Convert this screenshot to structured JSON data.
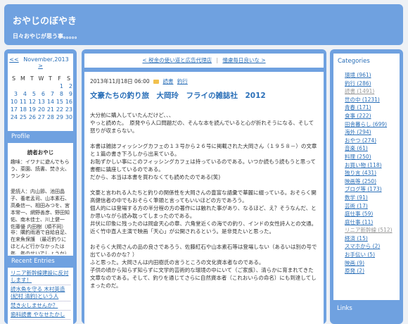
{
  "header": {
    "title": "おやじのぼやき",
    "description": "日々おやじが思う事。。。。。"
  },
  "calendar": {
    "prev": "<<",
    "month": "November,2013",
    "next": ">",
    "rows": [
      [
        "S",
        "M",
        "T",
        "W",
        "T",
        "F",
        "S"
      ],
      [
        "",
        "",
        "",
        "",
        "",
        "1",
        "2"
      ],
      [
        "3",
        "4",
        "5",
        "6",
        "7",
        "8",
        "9"
      ],
      [
        "10",
        "11",
        "12",
        "13",
        "14",
        "15",
        "16"
      ],
      [
        "17",
        "18",
        "19",
        "20",
        "21",
        "22",
        "23"
      ],
      [
        "24",
        "25",
        "26",
        "27",
        "28",
        "29",
        "30"
      ]
    ]
  },
  "profile": {
    "heading": "Profile",
    "name": "読者おやじ",
    "hobby": "趣味：イワナに遊んでもらう、菜園、読書、焚き火、ランタン",
    "fav_authors": "愛読人：内山節、池田晶子、養老孟司、山本素石、高桑信一、相田みつを、宮本常一、網野善彦、野田知佑、南木佳士、川上健一 佐藤優 内田樹（順不同）",
    "note": "非：購釣雨酒で自給自足、在来魚保護 （最近釣りにほとんど行かなかったは年、年のせいでしょうか）"
  },
  "recent": {
    "heading": "Recent Entries",
    "items": [
      "リニア新幹線建設に反対します！",
      "読水魚を守る 木村英造(紀村 清釣)という人",
      "焚き火しませんか？",
      "歯科読書 やなせたかし"
    ]
  },
  "nav": {
    "prev": "< 税金の使い道と広告代理店",
    "next": "慢慮毎日良いな >"
  },
  "post": {
    "date": "2013年11月18日 06:00",
    "tag1": "読書",
    "tag2": "釣行",
    "title": "文豪たちの釣り旅　大岡玲　フライの雑誌社　2012",
    "paragraphs": [
      "大分前に購入していたんだけど、、、\nやっと読めた。　原発やら人口問題だの、そんな本を読んでいると心が折れそうになる、そして怒りが収まらない。",
      "本書は雑誌フィッシングカフェの１３号から２６号に掲載された大岡さん（１９５８－）の文章と１篇の書き下ろしから出来ている。\nお恥ずかしい事にこのフィッシングカフェは持っているのである。いつか読もう読もうと思って書棚に鎮座しているのである。\nだから、本当は本書を買わなくても読めたのである(笑)",
      "文豪と言われる人たちと釣りの関係性を大岡さんの豊富な語彙で華麗に綴っている。おそらく開高健信者の中でもおそらく筆頭と言ってもいいほどの方であろう。\n個人的には登場する方の半分程の方の著作には触れた事があり、なるほど、え？そうなんだ、と か思いながら読み耽ってしまったのである。\n井伏に印象に残ったのは岡倉天心の章、六角堂近くの海での釣り、インドの女性詩人との文通。近く竹中直人主演で映画「天心」が公開されるという。是非見たいと思った。",
      "おそらく大岡さんの品の良さであろう、佐藤紅石や山本素石等は登場しない（あるいは別の号で出ているのかな？）\nふと思った。大岡さんは内田樹氏の言うところの文化資本者なのである。\n子供の頃から知らず知らずに文学的芸術的な環境の中にいて（ご家族）、清らかに育まれてきた文章なのである。そして、釣りを通じてさらに自然資本者（これおいらの命名）にも到達してしまったのだ。"
    ]
  },
  "categories": {
    "heading": "Categories",
    "items": [
      {
        "label": "環境 (961)",
        "dim": false
      },
      {
        "label": "釣行 (286)",
        "dim": false
      },
      {
        "label": "読書 (1491)",
        "dim": true
      },
      {
        "label": "世の中 (1231)",
        "dim": false
      },
      {
        "label": "青春 (171)",
        "dim": false
      },
      {
        "label": "食事 (222)",
        "dim": false
      },
      {
        "label": "田舎暮らし (699)",
        "dim": false
      },
      {
        "label": "海外 (294)",
        "dim": false
      },
      {
        "label": "おやつ (274)",
        "dim": false
      },
      {
        "label": "音楽 (61)",
        "dim": false
      },
      {
        "label": "料理 (250)",
        "dim": false
      },
      {
        "label": "お買い物 (118)",
        "dim": false
      },
      {
        "label": "独り言 (431)",
        "dim": false
      },
      {
        "label": "映画等 (250)",
        "dim": false
      },
      {
        "label": "ブログ等 (173)",
        "dim": false
      },
      {
        "label": "数学 (91)",
        "dim": false
      },
      {
        "label": "芸術 (17)",
        "dim": false
      },
      {
        "label": "庭仕事 (59)",
        "dim": false
      },
      {
        "label": "庭仕事 (11)",
        "dim": false
      },
      {
        "label": "リニア新幹線 (512)",
        "dim": true
      },
      {
        "label": "経済 (15)",
        "dim": false
      },
      {
        "label": "スマホから (2)",
        "dim": false
      },
      {
        "label": "お手伝い (5)",
        "dim": false
      },
      {
        "label": "映画 (9)",
        "dim": false
      },
      {
        "label": "原発 (2)",
        "dim": false
      }
    ]
  },
  "links": {
    "heading": "Links"
  },
  "colors": {
    "frame": "#6fa1e0",
    "link": "#2a6fb8",
    "page_bg": "#eef1f5"
  }
}
